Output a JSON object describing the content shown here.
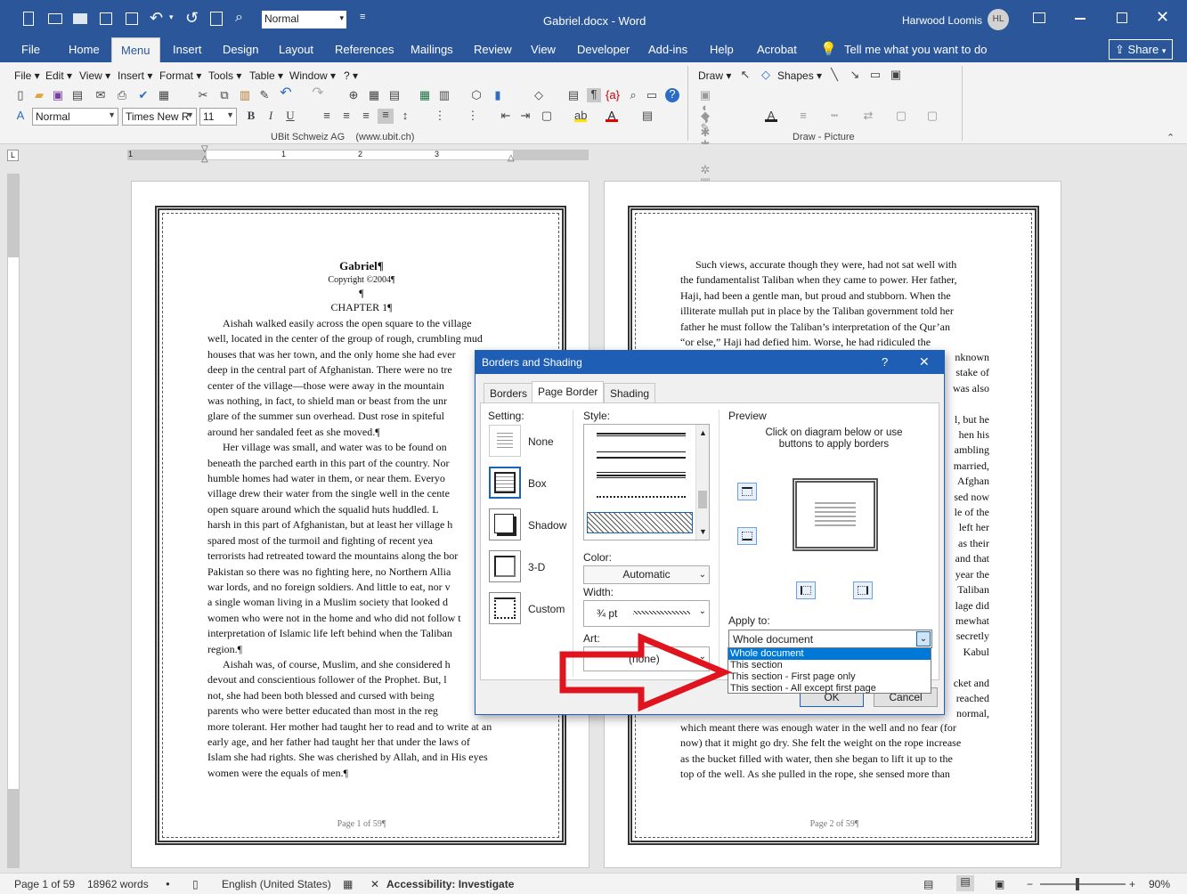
{
  "titlebar": {
    "style_box": "Normal",
    "doc_title": "Gabriel.docx - Word",
    "user_name": "Harwood Loomis",
    "user_initials": "HL"
  },
  "tabs": [
    "File",
    "Home",
    "Menu",
    "Insert",
    "Design",
    "Layout",
    "References",
    "Mailings",
    "Review",
    "View",
    "Developer",
    "Add-ins",
    "Help",
    "Acrobat"
  ],
  "tell_me": "Tell me what you want to do",
  "share_label": "Share",
  "menu_bar": [
    "File",
    "Edit",
    "View",
    "Insert",
    "Format",
    "Tools",
    "Table",
    "Window",
    "?"
  ],
  "draw_menu": [
    "Draw",
    "Shapes"
  ],
  "format": {
    "style": "Normal",
    "font": "Times New R",
    "size": "11"
  },
  "ribbon_labels": {
    "left_group": "UBit Schweiz AG    (www.ubit.ch)",
    "right_group": "Draw - Picture"
  },
  "ruler_numbers": [
    "1",
    "1",
    "2",
    "3"
  ],
  "page1": {
    "title": "Gabriel¶",
    "copyright": "Copyright ©2004¶",
    "pilcrow": "¶",
    "chapter": "CHAPTER 1¶",
    "lines": [
      "Aishah walked easily across the open square to the village",
      "well, located in the center of the group of rough, crumbling mud",
      "houses that was her town, and the only home she had ever",
      "deep in the central part of Afghanistan. There were no tre",
      "center of the village—those were away in the mountain",
      "was nothing, in fact, to shield man or beast from the unr",
      "glare of the summer sun overhead. Dust rose in spiteful",
      "around her sandaled feet as she moved.¶",
      "Her village was small, and water was to be found on",
      "beneath the parched earth in this part of the country. Nor",
      "humble homes had water in them, or near them. Everyo",
      "village drew their water from the single well in the cente",
      "open square around which the squalid huts huddled. L",
      "harsh in this part of Afghanistan, but at least her village h",
      "spared most of the turmoil and fighting of recent yea",
      "terrorists had retreated toward the mountains along the bor",
      "Pakistan so there was no fighting here, no Northern Allia",
      "war lords, and no foreign soldiers. And little to eat, nor v",
      "a single woman living in a Muslim society that looked d",
      "women who were not in the home and who did not follow t",
      "interpretation of Islamic life left behind when the Taliban",
      "region.¶",
      "Aishah was, of course, Muslim, and she considered h",
      "devout and conscientious follower of the Prophet. But, l",
      "not, she had been both blessed and cursed with being",
      "parents who were better educated than most in the reg",
      "more tolerant. Her mother had taught her to read and to write at an",
      "early age, and her father had taught her that under the laws of",
      "Islam she had rights. She was cherished by Allah, and in His eyes",
      "women were the equals of men.¶"
    ],
    "footer": "Page 1 of 59¶"
  },
  "page2": {
    "lines_top": [
      "Such views, accurate though they were, had not sat well with",
      "the fundamentalist Taliban when they came to power. Her father,",
      "Haji, had been a gentle man, but proud and stubborn. When the",
      "illiterate mullah put in place by the Taliban government told her",
      "father he must follow the Taliban’s interpretation of the Qur’an",
      "“or else,” Haji had defied him. Worse, he had ridiculed the"
    ],
    "right_fragments": [
      "nknown",
      "stake of",
      "was also",
      "l, but he",
      "hen his",
      "ambling",
      "married,",
      "Afghan",
      "sed now",
      "le of the",
      "left her",
      "as their",
      "and that",
      "year the",
      "Taliban",
      "lage did",
      "mewhat",
      "secretly",
      "Kabul",
      "cket and",
      "reached",
      "normal,"
    ],
    "lines_bottom": [
      "which meant there was enough water in the well and no fear (for",
      "now) that it might go dry. She felt the weight on the rope increase",
      "as the bucket filled with water, then she began to lift it up to the",
      "top of the well. As she pulled in the rope, she sensed more than"
    ],
    "footer": "Page 2 of 59¶"
  },
  "dialog": {
    "title": "Borders and Shading",
    "help": "?",
    "close": "✕",
    "tabs": [
      "Borders",
      "Page Border",
      "Shading"
    ],
    "setting_label": "Setting:",
    "settings": [
      "None",
      "Box",
      "Shadow",
      "3-D",
      "Custom"
    ],
    "style_label": "Style:",
    "color_label": "Color:",
    "color_value": "Automatic",
    "width_label": "Width:",
    "width_value": "¾ pt",
    "art_label": "Art:",
    "art_value": "(none)",
    "preview_label": "Preview",
    "preview_hint": "Click on diagram below or use buttons to apply borders",
    "apply_label": "Apply to:",
    "apply_value": "Whole document",
    "apply_options": [
      "Whole document",
      "This section",
      "This section - First page only",
      "This section - All except first page"
    ],
    "ok": "OK",
    "cancel": "Cancel"
  },
  "status": {
    "page": "Page 1 of 59",
    "words": "18962 words",
    "language": "English (United States)",
    "accessibility": "Accessibility: Investigate",
    "zoom": "90%"
  },
  "colors": {
    "title_blue": "#2b579a",
    "dialog_blue": "#1f5eb5",
    "arrow_red": "#e0141e"
  }
}
